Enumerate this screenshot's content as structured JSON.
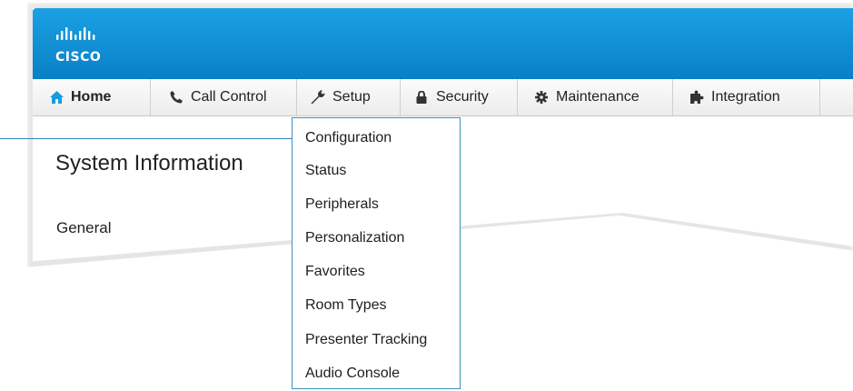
{
  "brand": {
    "logo_text": "CISCO",
    "banner_color": "#0a86cc"
  },
  "nav": [
    {
      "label": "Home",
      "icon": "home-icon",
      "active": true
    },
    {
      "label": "Call Control",
      "icon": "phone-icon"
    },
    {
      "label": "Setup",
      "icon": "wrench-icon"
    },
    {
      "label": "Security",
      "icon": "lock-icon"
    },
    {
      "label": "Maintenance",
      "icon": "gear-icon"
    },
    {
      "label": "Integration",
      "icon": "puzzle-icon"
    }
  ],
  "main": {
    "title": "System Information",
    "section": "General"
  },
  "setup_menu": {
    "items": [
      "Configuration",
      "Status",
      "Peripherals",
      "Personalization",
      "Favorites",
      "Room Types",
      "Presenter Tracking",
      "Audio Console"
    ]
  }
}
